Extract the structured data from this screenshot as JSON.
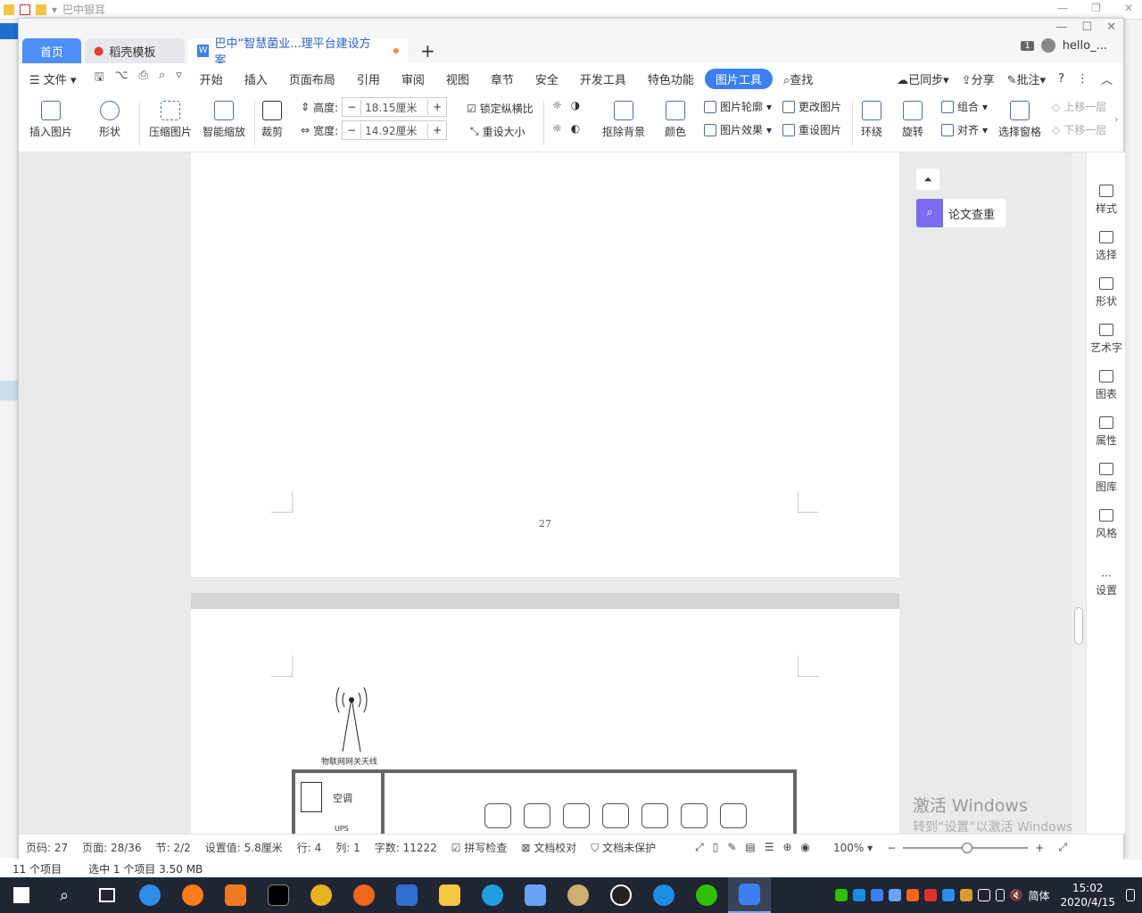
{
  "explorer": {
    "title": "巴中银耳",
    "status_items": "11 个项目",
    "status_selected": "选中 1 个项目  3.50 MB"
  },
  "tabs": {
    "home": "首页",
    "template": "稻壳模板",
    "doc": "巴中“智慧菌业...理平台建设方案"
  },
  "account": {
    "badge": "1",
    "name": "hello_..."
  },
  "menu": {
    "file": "文件",
    "items": [
      "开始",
      "插入",
      "页面布局",
      "引用",
      "审阅",
      "视图",
      "章节",
      "安全",
      "开发工具",
      "特色功能",
      "图片工具"
    ],
    "search": "查找",
    "sync": "已同步",
    "share": "分享",
    "comment": "批注"
  },
  "ribbon": {
    "insert_pic": "插入图片",
    "shape": "形状",
    "compress": "压缩图片",
    "smart_zoom": "智能缩放",
    "crop": "裁剪",
    "height_label": "高度:",
    "height_value": "18.15厘米",
    "width_label": "宽度:",
    "width_value": "14.92厘米",
    "lock_ratio": "锁定纵横比",
    "reset_size": "重设大小",
    "remove_bg": "抠除背景",
    "color": "颜色",
    "pic_outline": "图片轮廓",
    "pic_effect": "图片效果",
    "change_pic": "更改图片",
    "reset_pic": "重设图片",
    "wrap": "环绕",
    "rotate": "旋转",
    "group": "组合",
    "align": "对齐",
    "select_pane": "选择窗格",
    "bring_forward": "上移一层",
    "send_backward": "下移一层"
  },
  "document": {
    "page_number": "27",
    "antenna_label": "物联网网关天线",
    "room_ac": "空调",
    "room_ups": "UPS"
  },
  "side_panel": {
    "thesis_check": "论文查重"
  },
  "watermark": {
    "line1": "激活 Windows",
    "line2": "转到“设置”以激活 Windows。"
  },
  "right_tools": [
    "样式",
    "选择",
    "形状",
    "艺术字",
    "图表",
    "属性",
    "图库",
    "风格",
    "设置"
  ],
  "status": {
    "page_code": "页码: 27",
    "page": "页面: 28/36",
    "section": "节: 2/2",
    "setting": "设置值: 5.8厘米",
    "row": "行: 4",
    "col": "列: 1",
    "word_count": "字数: 11222",
    "spell": "拼写检查",
    "proof": "文档校对",
    "protect": "文档未保护",
    "zoom": "100%"
  },
  "taskbar": {
    "ime": "简体",
    "time": "15:02",
    "date": "2020/4/15"
  },
  "colors": {
    "accent": "#3b7ff0",
    "home_tab": "#4e8ef7",
    "taskbar": "#1f2533"
  }
}
